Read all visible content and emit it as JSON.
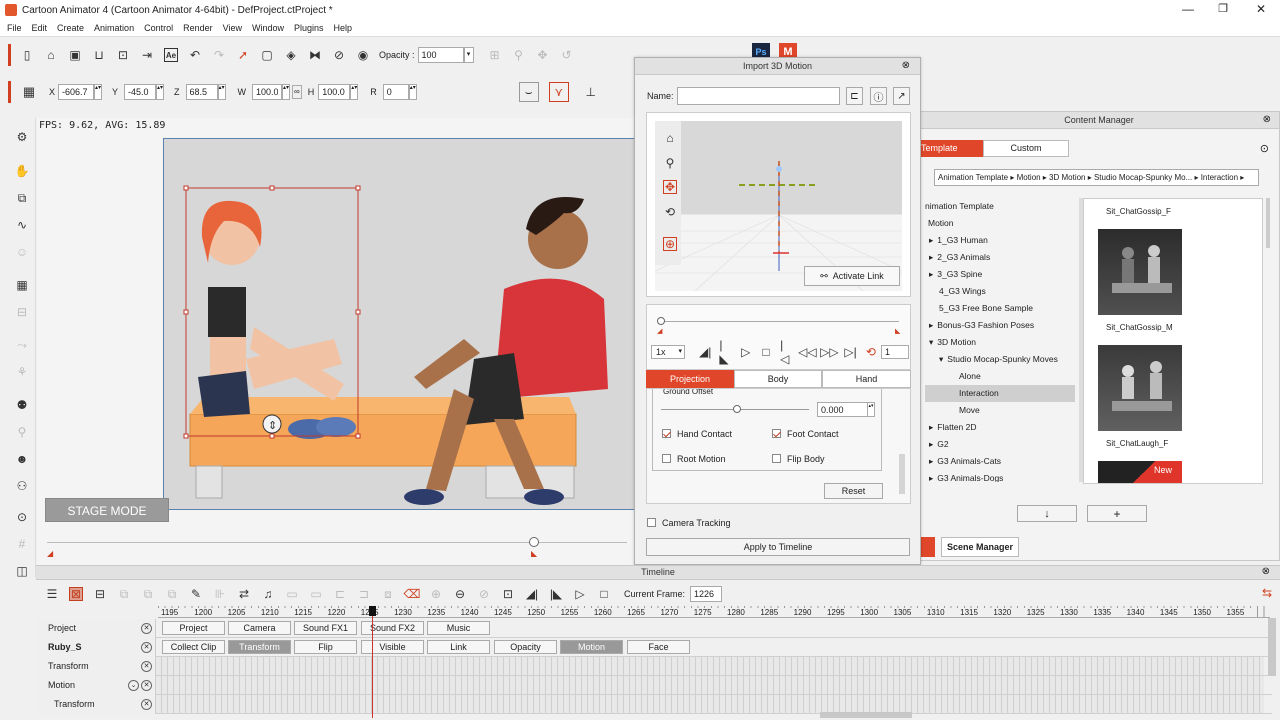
{
  "window": {
    "title": "Cartoon Animator 4  (Cartoon Animator 4-64bit) - DefProject.ctProject *",
    "min": "—",
    "max": "❐",
    "close": "✕"
  },
  "menu": [
    "File",
    "Edit",
    "Create",
    "Animation",
    "Control",
    "Render",
    "View",
    "Window",
    "Plugins",
    "Help"
  ],
  "toolbar": {
    "opacity_label": "Opacity :",
    "opacity_value": "100"
  },
  "transform": {
    "x_label": "X",
    "x": "-606.7",
    "y_label": "Y",
    "y": "-45.0",
    "z_label": "Z",
    "z": "68.5",
    "w_label": "W",
    "w": "100.0",
    "h_label": "H",
    "h": "100.0",
    "r_label": "R",
    "r": "0"
  },
  "stage": {
    "fps": "FPS: 9.62, AVG: 15.89",
    "mode": "STAGE MODE"
  },
  "import_motion": {
    "title": "Import 3D Motion",
    "name_label": "Name:",
    "name_value": "",
    "activate_link": "Activate Link",
    "speed": "1x",
    "loop_count": "1",
    "tabs": [
      "Projection",
      "Body",
      "Hand"
    ],
    "ground_offset_label": "Ground Offset",
    "ground_offset": "0.000",
    "hand_contact": "Hand Contact",
    "foot_contact": "Foot Contact",
    "root_motion": "Root Motion",
    "flip_body": "Flip Body",
    "reset": "Reset",
    "camera_tracking": "Camera Tracking",
    "apply": "Apply to Timeline"
  },
  "content_manager": {
    "title": "Content Manager",
    "tab_template": "Template",
    "tab_custom": "Custom",
    "breadcrumb": "Animation Template ▸ Motion ▸ 3D Motion ▸ Studio Mocap-Spunky Mo... ▸ Interaction ▸",
    "tree": [
      {
        "label": "nimation Template",
        "indent": 0,
        "arrow": ""
      },
      {
        "label": "Motion",
        "indent": 0,
        "arrow": ""
      },
      {
        "label": "1_G3 Human",
        "indent": 1,
        "arrow": "▸"
      },
      {
        "label": "2_G3 Animals",
        "indent": 1,
        "arrow": "▸"
      },
      {
        "label": "3_G3 Spine",
        "indent": 1,
        "arrow": "▸"
      },
      {
        "label": "4_G3 Wings",
        "indent": 1,
        "arrow": ""
      },
      {
        "label": "5_G3 Free Bone Sample",
        "indent": 1,
        "arrow": ""
      },
      {
        "label": "Bonus-G3 Fashion Poses",
        "indent": 1,
        "arrow": "▸"
      },
      {
        "label": "3D Motion",
        "indent": 1,
        "arrow": "▾"
      },
      {
        "label": "Studio Mocap-Spunky Moves",
        "indent": 2,
        "arrow": "▾"
      },
      {
        "label": "Alone",
        "indent": 3,
        "arrow": ""
      },
      {
        "label": "Interaction",
        "indent": 3,
        "arrow": "",
        "selected": true
      },
      {
        "label": "Move",
        "indent": 3,
        "arrow": ""
      },
      {
        "label": "Flatten 2D",
        "indent": 1,
        "arrow": "▸"
      },
      {
        "label": "G2",
        "indent": 1,
        "arrow": "▸"
      },
      {
        "label": "G3 Animals-Cats",
        "indent": 1,
        "arrow": "▸"
      },
      {
        "label": "G3 Animals-Dogs",
        "indent": 1,
        "arrow": "▸"
      }
    ],
    "thumbs": [
      "Sit_ChatGossip_F",
      "Sit_ChatGossip_M",
      "Sit_ChatLaugh_F"
    ],
    "new_badge": "New",
    "scene_manager": "Scene Manager",
    "down": "↓",
    "add": "+"
  },
  "timeline": {
    "title": "Timeline",
    "current_frame_label": "Current Frame:",
    "current_frame": "1226",
    "ruler": [
      "1195",
      "1200",
      "1205",
      "1210",
      "1215",
      "1220",
      "1225",
      "1230",
      "1235",
      "1240",
      "1245",
      "1250",
      "1255",
      "1260",
      "1265",
      "1270",
      "1275",
      "1280",
      "1285",
      "1290",
      "1295",
      "1300",
      "1305",
      "1310",
      "1315",
      "1320",
      "1325",
      "1330",
      "1335",
      "1340",
      "1345",
      "1350",
      "1355"
    ],
    "rows": {
      "project": "Project",
      "ruby": "Ruby_S",
      "transform": "Transform",
      "motion": "Motion",
      "transform2": "Transform"
    },
    "project_btns": [
      "Project",
      "Camera",
      "Sound FX1",
      "Sound FX2",
      "Music"
    ],
    "ruby_btns": [
      "Collect Clip",
      "Transform",
      "Flip",
      "Visible",
      "Link",
      "Opacity",
      "Motion",
      "Face"
    ]
  }
}
